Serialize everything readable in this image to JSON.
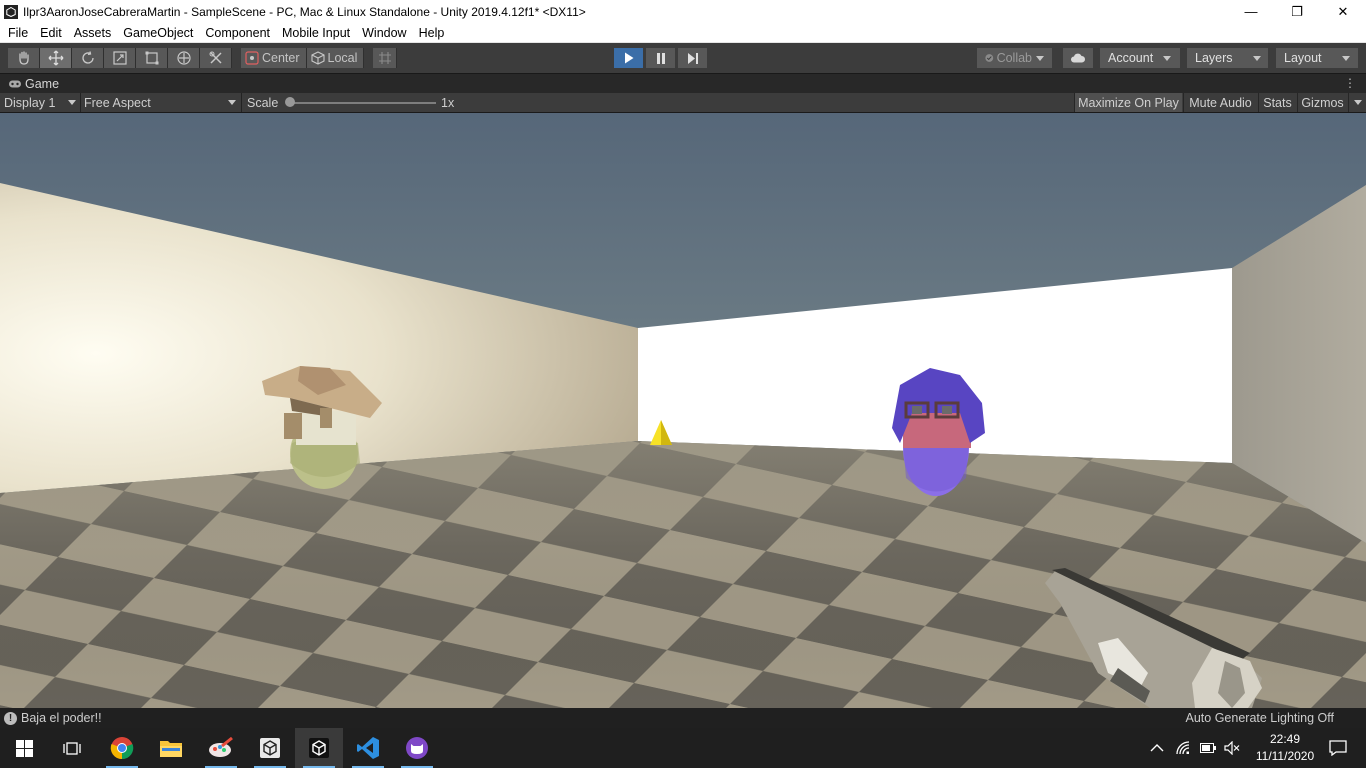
{
  "window": {
    "title": "Ilpr3AaronJoseCabreraMartin - SampleScene - PC, Mac & Linux Standalone - Unity 2019.4.12f1* <DX11>",
    "minimize": "—",
    "maximize": "❐",
    "close": "✕"
  },
  "menu": [
    "File",
    "Edit",
    "Assets",
    "GameObject",
    "Component",
    "Mobile Input",
    "Window",
    "Help"
  ],
  "toolbar": {
    "tools": [
      "hand-tool",
      "move-tool",
      "rotate-tool",
      "scale-tool",
      "rect-tool",
      "transform-tool",
      "custom-tool"
    ],
    "active_tool": "move-tool",
    "pivot_label": "Center",
    "space_label": "Local",
    "playing": true,
    "collab_label": "Collab",
    "account_label": "Account",
    "layers_label": "Layers",
    "layout_label": "Layout"
  },
  "game_view": {
    "tab_label": "Game",
    "display_label": "Display 1",
    "aspect_label": "Free Aspect",
    "scale_label": "Scale",
    "scale_value": "1x",
    "scale_level": 0.0,
    "maximize_on_play": "Maximize On Play",
    "mute_audio": "Mute Audio",
    "stats": "Stats",
    "gizmos": "Gizmos"
  },
  "status": {
    "message": "Baja el poder!!",
    "lighting": "Auto Generate Lighting Off"
  },
  "taskbar": {
    "apps": [
      "windows-start",
      "task-view",
      "chrome",
      "file-explorer",
      "paint-app",
      "unity-hub",
      "unity-editor",
      "vs-code",
      "github-desktop"
    ],
    "time": "22:49",
    "date": "11/11/2020"
  },
  "colors": {
    "accent_play": "#3b6ea8",
    "floor_light": "#a49c88",
    "floor_dark": "#5f5b52",
    "enemy_left": "#bcc08a",
    "enemy_right": "#8b6fe8"
  }
}
